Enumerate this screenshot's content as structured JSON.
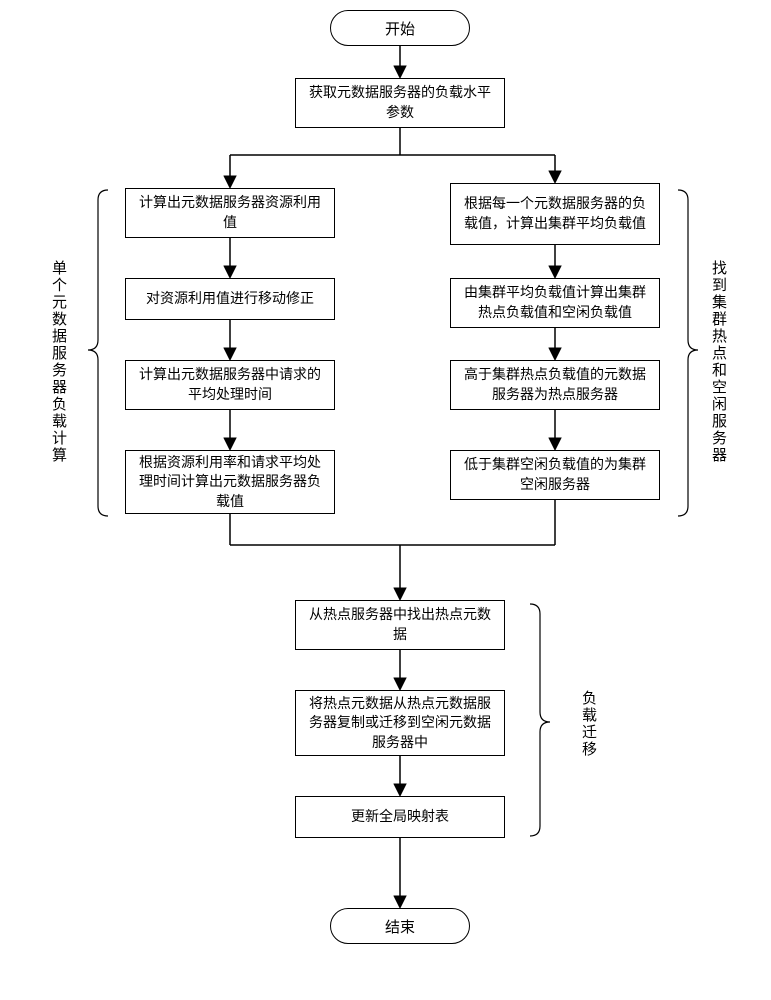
{
  "flow": {
    "start": "开始",
    "end": "结束",
    "step1": "获取元数据服务器的负载水平参数",
    "left": {
      "s1": "计算出元数据服务器资源利用值",
      "s2": "对资源利用值进行移动修正",
      "s3": "计算出元数据服务器中请求的平均处理时间",
      "s4": "根据资源利用率和请求平均处理时间计算出元数据服务器负载值"
    },
    "right": {
      "s1": "根据每一个元数据服务器的负载值，计算出集群平均负载值",
      "s2": "由集群平均负载值计算出集群热点负载值和空闲负载值",
      "s3": "高于集群热点负载值的元数据服务器为热点服务器",
      "s4": "低于集群空闲负载值的为集群空闲服务器"
    },
    "merge": {
      "s1": "从热点服务器中找出热点元数据",
      "s2": "将热点元数据从热点元数据服务器复制或迁移到空闲元数据服务器中",
      "s3": "更新全局映射表"
    }
  },
  "labels": {
    "leftBrace": "单个元数据服务器负载计算",
    "rightBrace": "找到集群热点和空闲服务器",
    "bottomBrace": "负载迁移"
  }
}
